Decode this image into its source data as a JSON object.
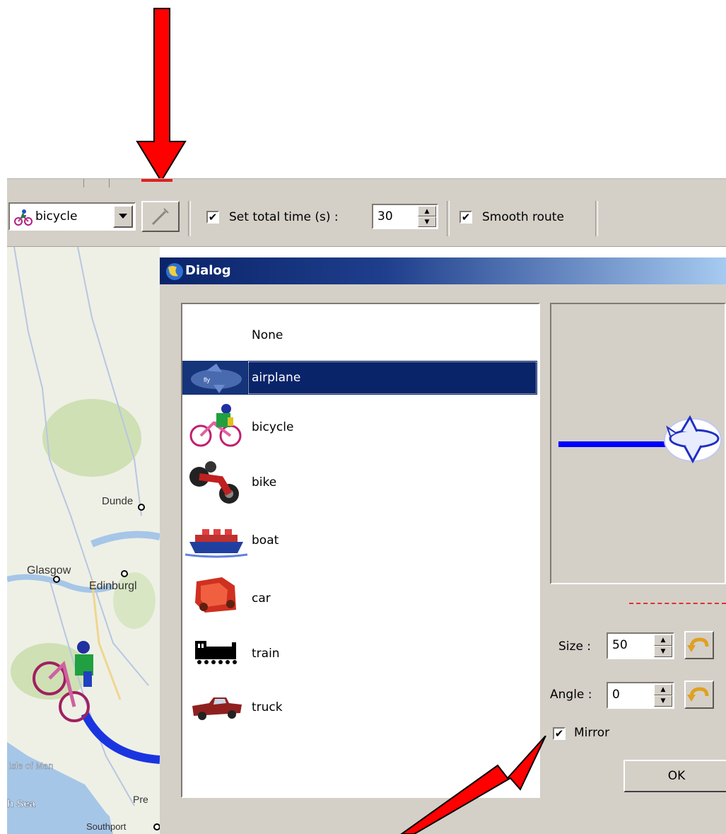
{
  "toolbar": {
    "vehicle_select": {
      "value": "bicycle",
      "icon": "bicycle-icon"
    },
    "set_total_time": {
      "checked": true,
      "label": "Set total time (s) :",
      "value": "30"
    },
    "smooth_route": {
      "checked": true,
      "label": "Smooth route"
    }
  },
  "map": {
    "labels": [
      "Dunde",
      "Glasgow",
      "Edinburgl",
      "Isle of Man",
      "h Sea",
      "Pre",
      "Southport"
    ],
    "route_color": "#1a35e0"
  },
  "dialog": {
    "title": "Dialog",
    "vehicles": [
      {
        "label": "None",
        "icon": ""
      },
      {
        "label": "airplane",
        "icon": "airplane-icon",
        "selected": true
      },
      {
        "label": "bicycle",
        "icon": "bicycle-icon"
      },
      {
        "label": "bike",
        "icon": "motorbike-icon"
      },
      {
        "label": "boat",
        "icon": "boat-icon"
      },
      {
        "label": "car",
        "icon": "car-icon"
      },
      {
        "label": "train",
        "icon": "train-icon"
      },
      {
        "label": "truck",
        "icon": "truck-icon"
      }
    ],
    "size": {
      "label": "Size :",
      "value": "50"
    },
    "angle": {
      "label": "Angle :",
      "value": "0"
    },
    "mirror": {
      "label": "Mirror",
      "checked": true
    },
    "ok_label": "OK"
  },
  "colors": {
    "selection": "#0a246a",
    "window_face": "#d4d0c8",
    "annotation_arrow": "#ff0000",
    "preview_route": "#0000ff"
  }
}
